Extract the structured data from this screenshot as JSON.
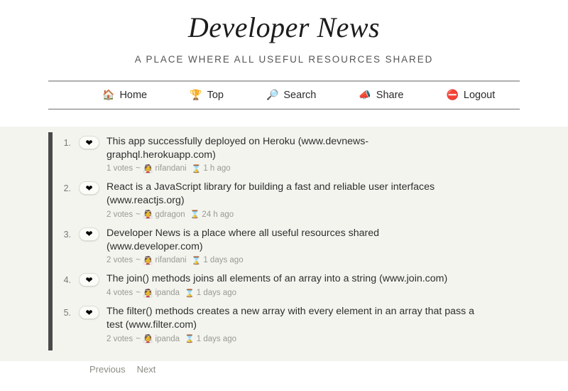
{
  "header": {
    "title": "Developer News",
    "subtitle": "A place where all useful resources shared"
  },
  "nav": {
    "items": [
      {
        "label": "Home",
        "icon": "🏠",
        "icon_name": "house-icon"
      },
      {
        "label": "Top",
        "icon": "🏆",
        "icon_name": "trophy-icon"
      },
      {
        "label": "Search",
        "icon": "🔎",
        "icon_name": "magnifying-glass-icon"
      },
      {
        "label": "Share",
        "icon": "📣",
        "icon_name": "megaphone-icon"
      },
      {
        "label": "Logout",
        "icon": "⛔",
        "icon_name": "no-entry-icon"
      }
    ]
  },
  "news": {
    "vote_icon": "❤",
    "user_icon": "👰",
    "time_icon": "⌛",
    "separator": "~",
    "items": [
      {
        "index": "1.",
        "title": "This app successfully deployed on Heroku (www.devnews-graphql.herokuapp.com)",
        "votes": "1 votes",
        "user": "rifandani",
        "time": "1 h ago"
      },
      {
        "index": "2.",
        "title": "React is a JavaScript library for building a fast and reliable user interfaces (www.reactjs.org)",
        "votes": "2 votes",
        "user": "gdragon",
        "time": "24 h ago"
      },
      {
        "index": "3.",
        "title": "Developer News is a place where all useful resources shared (www.developer.com)",
        "votes": "2 votes",
        "user": "rifandani",
        "time": "1 days ago"
      },
      {
        "index": "4.",
        "title": "The join() methods joins all elements of an array into a string (www.join.com)",
        "votes": "4 votes",
        "user": "ipanda",
        "time": "1 days ago"
      },
      {
        "index": "5.",
        "title": "The filter() methods creates a new array with every element in an array that pass a test (www.filter.com)",
        "votes": "2 votes",
        "user": "ipanda",
        "time": "1 days ago"
      }
    ]
  },
  "pagination": {
    "previous_label": "Previous",
    "next_label": "Next"
  },
  "colors": {
    "page_background": "#ffffff",
    "content_background": "#f4f4ef",
    "accent_bar": "#4a4a4a",
    "title_text": "#1c1c1c",
    "meta_text": "#9a9a93"
  }
}
